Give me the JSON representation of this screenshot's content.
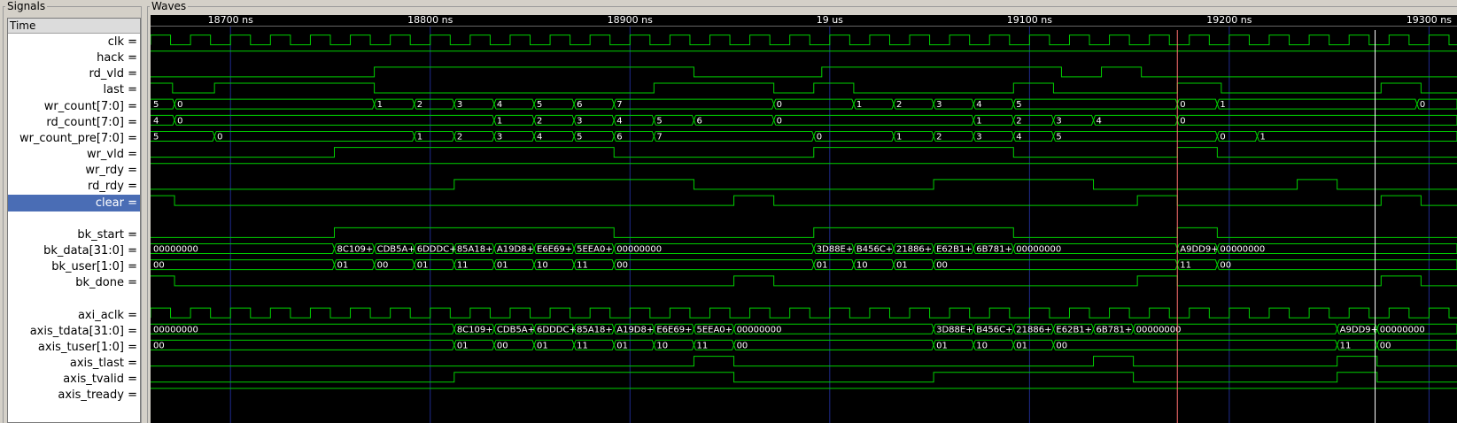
{
  "panels": {
    "signals_title": "Signals",
    "waves_title": "Waves"
  },
  "time_header": "Time",
  "time_ticks": [
    {
      "label": "18700 ns",
      "t": 18700
    },
    {
      "label": "18800 ns",
      "t": 18800
    },
    {
      "label": "18900 ns",
      "t": 18900
    },
    {
      "label": "19 us",
      "t": 19000
    },
    {
      "label": "19100 ns",
      "t": 19100
    },
    {
      "label": "19200 ns",
      "t": 19200
    },
    {
      "label": "19300 ns",
      "t": 19300
    }
  ],
  "time_range_ns": [
    18660,
    19314
  ],
  "colors": {
    "wave": "#00d000",
    "grid": "#1e2a8c",
    "marker": "#ff7070",
    "cursor": "#ffffff",
    "selection": "#4a6db5",
    "background": "#000000"
  },
  "markers": {
    "marker_ns": 19174,
    "cursor_ns": 19273
  },
  "signals": [
    {
      "name": "clk =",
      "type": "clock",
      "period_ns": 20,
      "first_rise_ns": 18660
    },
    {
      "name": "hack =",
      "type": "bit",
      "init": 1,
      "edges": []
    },
    {
      "name": "rd_vld =",
      "type": "bit",
      "init": 0,
      "edges": [
        18772,
        18932,
        18996,
        19116,
        19136,
        19156
      ]
    },
    {
      "name": "last =",
      "type": "bit",
      "init": 1,
      "edges": [
        18671,
        18692,
        18772,
        18912,
        18972,
        18992,
        19012,
        19092,
        19112,
        19174,
        19196,
        19276,
        19296
      ]
    },
    {
      "name": "wr_count[7:0] =",
      "type": "bus",
      "values": [
        [
          18660,
          "5"
        ],
        [
          18672,
          "0"
        ],
        [
          18772,
          "1"
        ],
        [
          18792,
          "2"
        ],
        [
          18812,
          "3"
        ],
        [
          18832,
          "4"
        ],
        [
          18852,
          "5"
        ],
        [
          18872,
          "6"
        ],
        [
          18892,
          "7"
        ],
        [
          18972,
          "0"
        ],
        [
          19012,
          "1"
        ],
        [
          19032,
          "2"
        ],
        [
          19052,
          "3"
        ],
        [
          19072,
          "4"
        ],
        [
          19092,
          "5"
        ],
        [
          19174,
          "0"
        ],
        [
          19194,
          "1"
        ],
        [
          19294,
          "0"
        ]
      ]
    },
    {
      "name": "rd_count[7:0] =",
      "type": "bus",
      "values": [
        [
          18660,
          "4"
        ],
        [
          18672,
          "0"
        ],
        [
          18832,
          "1"
        ],
        [
          18852,
          "2"
        ],
        [
          18872,
          "3"
        ],
        [
          18892,
          "4"
        ],
        [
          18912,
          "5"
        ],
        [
          18932,
          "6"
        ],
        [
          18972,
          "0"
        ],
        [
          19072,
          "1"
        ],
        [
          19092,
          "2"
        ],
        [
          19112,
          "3"
        ],
        [
          19132,
          "4"
        ],
        [
          19174,
          "0"
        ]
      ]
    },
    {
      "name": "wr_count_pre[7:0] =",
      "type": "bus",
      "values": [
        [
          18660,
          "5"
        ],
        [
          18692,
          "0"
        ],
        [
          18792,
          "1"
        ],
        [
          18812,
          "2"
        ],
        [
          18832,
          "3"
        ],
        [
          18852,
          "4"
        ],
        [
          18872,
          "5"
        ],
        [
          18892,
          "6"
        ],
        [
          18912,
          "7"
        ],
        [
          18992,
          "0"
        ],
        [
          19032,
          "1"
        ],
        [
          19052,
          "2"
        ],
        [
          19072,
          "3"
        ],
        [
          19092,
          "4"
        ],
        [
          19112,
          "5"
        ],
        [
          19194,
          "0"
        ],
        [
          19214,
          "1"
        ]
      ]
    },
    {
      "name": "wr_vld =",
      "type": "bit",
      "init": 0,
      "edges": [
        18752,
        18892,
        18992,
        19092,
        19174,
        19194
      ]
    },
    {
      "name": "wr_rdy =",
      "type": "bit",
      "init": 1,
      "edges": []
    },
    {
      "name": "rd_rdy =",
      "type": "bit",
      "init": 0,
      "edges": [
        18812,
        18932,
        19052,
        19132,
        19234,
        19254
      ]
    },
    {
      "name": "clear =",
      "type": "bit",
      "init": 1,
      "edges": [
        18672,
        18952,
        18972,
        19154,
        19174,
        19276,
        19296
      ],
      "selected": true
    },
    {
      "name": "",
      "type": "blank"
    },
    {
      "name": "bk_start =",
      "type": "bit",
      "init": 0,
      "edges": [
        18752,
        18892,
        18992,
        19092,
        19174,
        19194
      ]
    },
    {
      "name": "bk_data[31:0] =",
      "type": "bus",
      "values": [
        [
          18660,
          "00000000"
        ],
        [
          18752,
          "8C109+"
        ],
        [
          18772,
          "CDB5A+"
        ],
        [
          18792,
          "6DDDC+"
        ],
        [
          18812,
          "85A18+"
        ],
        [
          18832,
          "A19D8+"
        ],
        [
          18852,
          "E6E69+"
        ],
        [
          18872,
          "5EEA0+"
        ],
        [
          18892,
          "00000000"
        ],
        [
          18992,
          "3D88E+"
        ],
        [
          19012,
          "B456C+"
        ],
        [
          19032,
          "21886+"
        ],
        [
          19052,
          "E62B1+"
        ],
        [
          19072,
          "6B781+"
        ],
        [
          19092,
          "00000000"
        ],
        [
          19174,
          "A9DD9+"
        ],
        [
          19194,
          "00000000"
        ]
      ]
    },
    {
      "name": "bk_user[1:0] =",
      "type": "bus",
      "values": [
        [
          18660,
          "00"
        ],
        [
          18752,
          "01"
        ],
        [
          18772,
          "00"
        ],
        [
          18792,
          "01"
        ],
        [
          18812,
          "11"
        ],
        [
          18832,
          "01"
        ],
        [
          18852,
          "10"
        ],
        [
          18872,
          "11"
        ],
        [
          18892,
          "00"
        ],
        [
          18992,
          "01"
        ],
        [
          19012,
          "10"
        ],
        [
          19032,
          "01"
        ],
        [
          19052,
          "00"
        ],
        [
          19174,
          "11"
        ],
        [
          19194,
          "00"
        ]
      ]
    },
    {
      "name": "bk_done =",
      "type": "bit",
      "init": 1,
      "edges": [
        18672,
        18952,
        18972,
        19154,
        19174,
        19276,
        19296
      ]
    },
    {
      "name": "",
      "type": "blank"
    },
    {
      "name": "axi_aclk =",
      "type": "clock",
      "period_ns": 20,
      "first_rise_ns": 18660
    },
    {
      "name": "axis_tdata[31:0] =",
      "type": "bus",
      "values": [
        [
          18660,
          "00000000"
        ],
        [
          18812,
          "8C109+"
        ],
        [
          18832,
          "CDB5A+"
        ],
        [
          18852,
          "6DDDC+"
        ],
        [
          18872,
          "85A18+"
        ],
        [
          18892,
          "A19D8+"
        ],
        [
          18912,
          "E6E69+"
        ],
        [
          18932,
          "5EEA0+"
        ],
        [
          18952,
          "00000000"
        ],
        [
          19052,
          "3D88E+"
        ],
        [
          19072,
          "B456C+"
        ],
        [
          19092,
          "21886+"
        ],
        [
          19112,
          "E62B1+"
        ],
        [
          19132,
          "6B781+"
        ],
        [
          19152,
          "00000000"
        ],
        [
          19254,
          "A9DD9+"
        ],
        [
          19274,
          "00000000"
        ]
      ]
    },
    {
      "name": "axis_tuser[1:0] =",
      "type": "bus",
      "values": [
        [
          18660,
          "00"
        ],
        [
          18812,
          "01"
        ],
        [
          18832,
          "00"
        ],
        [
          18852,
          "01"
        ],
        [
          18872,
          "11"
        ],
        [
          18892,
          "01"
        ],
        [
          18912,
          "10"
        ],
        [
          18932,
          "11"
        ],
        [
          18952,
          "00"
        ],
        [
          19052,
          "01"
        ],
        [
          19072,
          "10"
        ],
        [
          19092,
          "01"
        ],
        [
          19112,
          "00"
        ],
        [
          19254,
          "11"
        ],
        [
          19274,
          "00"
        ]
      ]
    },
    {
      "name": "axis_tlast =",
      "type": "bit",
      "init": 0,
      "edges": [
        18932,
        18952,
        19132,
        19152,
        19254,
        19274
      ]
    },
    {
      "name": "axis_tvalid =",
      "type": "bit",
      "init": 0,
      "edges": [
        18812,
        18952,
        19052,
        19152,
        19254,
        19274
      ]
    },
    {
      "name": "axis_tready =",
      "type": "bit",
      "init": 1,
      "edges": []
    }
  ]
}
